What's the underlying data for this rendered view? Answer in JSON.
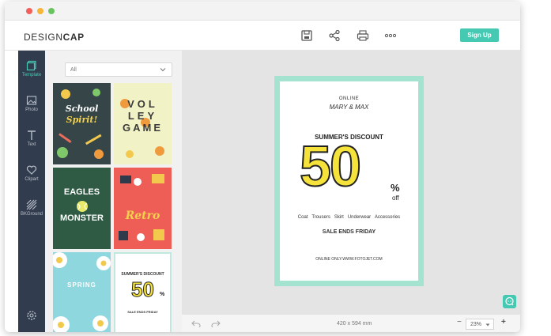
{
  "app": {
    "logo_part1": "DESIGN",
    "logo_part2": "CAP"
  },
  "header": {
    "tools": [
      {
        "name": "save-icon"
      },
      {
        "name": "share-icon"
      },
      {
        "name": "print-icon"
      },
      {
        "name": "more-icon"
      }
    ],
    "signup_label": "Sign Up"
  },
  "sidebar": {
    "items": [
      {
        "label": "Template",
        "icon": "template-icon"
      },
      {
        "label": "Photo",
        "icon": "photo-icon"
      },
      {
        "label": "Text",
        "icon": "text-icon"
      },
      {
        "label": "Clipart",
        "icon": "clipart-icon"
      },
      {
        "label": "BKGround",
        "icon": "background-icon"
      }
    ],
    "settings_icon": "gear-icon"
  },
  "panel": {
    "filter_value": "All",
    "thumbs": [
      {
        "title1": "School",
        "title2": "Spirit!"
      },
      {
        "title1": "VOL",
        "title2": "LEY",
        "title3": "GAME"
      },
      {
        "title1": "EAGLES",
        "title2": "MONSTER"
      },
      {
        "title1": "Retro"
      },
      {
        "title1": "SPRING"
      },
      {
        "title1": "SUMMER'S DISCOUNT",
        "big": "50",
        "pct": "%",
        "footer": "SALE ENDS FRIDAY"
      }
    ]
  },
  "poster": {
    "online": "ONLINE",
    "brand": "MARY & MAX",
    "headline": "SUMMER'S DISCOUNT",
    "big_number": "50",
    "percent": "%",
    "off": "off",
    "categories": "Coat   Trousers   Skirt   Underwear   Accessories",
    "sale": "SALE ENDS FRIDAY",
    "footer": "ONLINE ONLY.WWW.FOTOJET.COM"
  },
  "bottombar": {
    "size_label": "420 x 594 mm",
    "zoom": "23%",
    "minus": "−",
    "plus": "+"
  },
  "colors": {
    "accent": "#45c9b2",
    "sidebar": "#313d4e",
    "poster_border": "#a4e3cf",
    "yellow": "#f5e23a"
  }
}
